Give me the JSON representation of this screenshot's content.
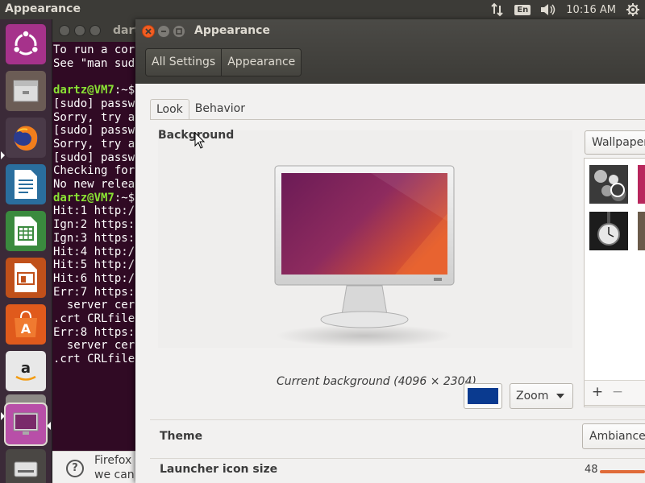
{
  "top_panel": {
    "title": "Appearance",
    "keyboard": "En",
    "clock": "10:16 AM",
    "icons": [
      "network-icon",
      "keyboard-icon",
      "volume-icon",
      "gear-icon"
    ]
  },
  "launcher": {
    "items": [
      "ubuntu-icon",
      "files-icon",
      "firefox-icon",
      "writer-icon",
      "calc-icon",
      "impress-icon",
      "software-center-icon",
      "amazon-icon",
      "settings-icon",
      "terminal-icon",
      "drive-icon"
    ]
  },
  "terminal": {
    "title": "dart",
    "lines": [
      {
        "text": "To run a cor"
      },
      {
        "text": "See \"man sud"
      },
      {
        "text": ""
      },
      {
        "prompt": "dartz@VM7",
        "rest": ":~$"
      },
      {
        "text": "[sudo] passw"
      },
      {
        "text": "Sorry, try a"
      },
      {
        "text": "[sudo] passw"
      },
      {
        "text": "Sorry, try a"
      },
      {
        "text": "[sudo] passw"
      },
      {
        "text": "Checking for"
      },
      {
        "text": "No new relea"
      },
      {
        "prompt": "dartz@VM7",
        "rest": ":~$"
      },
      {
        "text": "Hit:1 http:/"
      },
      {
        "text": "Ign:2 https:"
      },
      {
        "text": "Ign:3 https:"
      },
      {
        "text": "Hit:4 http:/"
      },
      {
        "text": "Hit:5 http:/"
      },
      {
        "text": "Hit:6 http:/"
      },
      {
        "text": "Err:7 https:"
      },
      {
        "text": "  server cer"
      },
      {
        "text": ".crt CRLfile"
      },
      {
        "text": "Err:8 https:"
      },
      {
        "text": "  server cer"
      },
      {
        "text": ".crt CRLfile"
      }
    ]
  },
  "help_bar": {
    "line1": "Firefox",
    "line2": "we can"
  },
  "window": {
    "title": "Appearance",
    "breadcrumb": [
      "All Settings",
      "Appearance"
    ]
  },
  "tabs": [
    {
      "label": "Look",
      "active": true
    },
    {
      "label": "Behavior",
      "active": false
    }
  ],
  "background": {
    "heading": "Background",
    "current_label": "Current background (4096 × 2304)",
    "color": "#0a3a8f",
    "mode": "Zoom"
  },
  "wallpapers": {
    "source": "Wallpapers",
    "add_label": "+",
    "remove_label": "−"
  },
  "theme": {
    "label": "Theme",
    "value": "Ambiance"
  },
  "launcher_icon_size": {
    "label": "Launcher icon size",
    "value": "48"
  },
  "colors": {
    "accent": "#e06b38",
    "close_button": "#f15d22",
    "terminal_bg": "#300a24",
    "prompt": "#8ae234"
  }
}
